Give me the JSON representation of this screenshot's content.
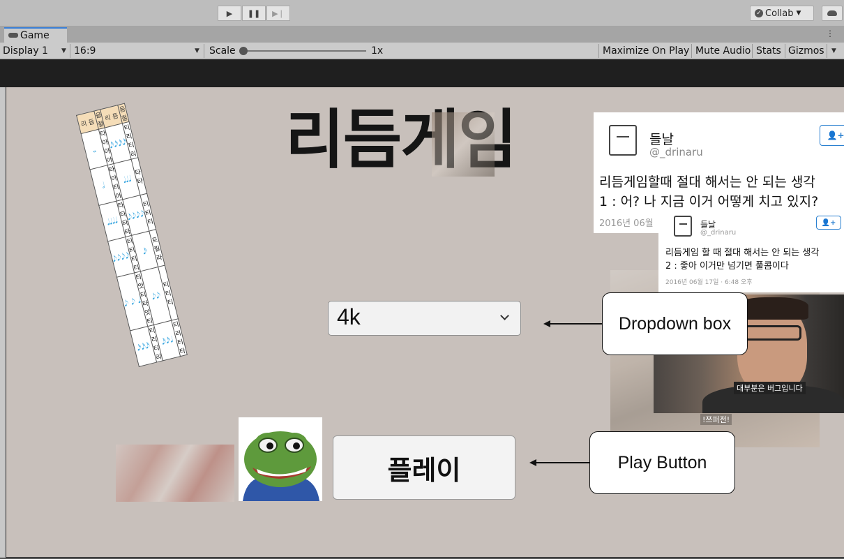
{
  "toolbar": {
    "collab_label": "Collab"
  },
  "tabs": [
    {
      "label": "Game"
    }
  ],
  "controls": {
    "display": "Display 1",
    "aspect": "16:9",
    "scale_label": "Scale",
    "scale_value": "1x",
    "maximize_on_play": "Maximize On Play",
    "mute_audio": "Mute Audio",
    "stats": "Stats",
    "gizmos": "Gizmos"
  },
  "game": {
    "title": "리듬게임",
    "dropdown_value": "4k",
    "play_button": "플레이"
  },
  "rhythm_table": {
    "headers": [
      "리 듬",
      "음 절",
      "리 듬",
      "음 절"
    ],
    "rows": [
      [
        "𝅝",
        "타 아 아 아",
        "𝅘𝅥𝅯𝅘𝅥𝅯𝅘𝅥𝅯𝅘𝅥𝅯",
        "티리 티리"
      ],
      [
        "𝅗𝅥",
        "타 아 타 아",
        "𝅘𝅥𝅘𝅥𝅘𝅥",
        "타 타"
      ],
      [
        "𝅘𝅥𝅘𝅥𝅘𝅥𝅘𝅥",
        "타 타 타 타",
        "𝅘𝅥𝅮𝅘𝅥𝅮𝅘𝅥𝅮𝅘𝅥𝅮",
        "티 티 티"
      ],
      [
        "𝅘𝅥𝅮𝅘𝅥𝅮𝅘𝅥𝅮𝅘𝅥𝅮",
        "티티 티티",
        "𝅘𝅥𝅯",
        "트릴라"
      ],
      [
        "𝅘𝅥𝅮 𝅘𝅥𝅮 𝅘𝅥",
        "타앗티 타앗티",
        "𝅘𝅥𝅮𝅘𝅥𝅮",
        "티티 티"
      ],
      [
        "𝅘𝅥𝅯𝅘𝅥𝅯𝅘𝅥𝅯",
        "티리 티리",
        "𝅘𝅥𝅯𝅘𝅥𝅯𝅘𝅥",
        "티리티 타"
      ]
    ]
  },
  "tweet1": {
    "name": "들날",
    "handle": "@_drinaru",
    "line1": "리듬게임할때 절대 해서는 안 되는 생각",
    "line2": "1 : 어? 나 지금 이거 어떻게 치고 있지?",
    "date": "2016년 06월"
  },
  "tweet2": {
    "name": "들날",
    "handle": "@_drinaru",
    "line1": "리듬게임 할 때 절대 해서는 안 되는 생각",
    "line2": "2 : 좋아 이거만 넘기면 풀콤이다",
    "date": "2016년 06월 17일 · 6:48 오후"
  },
  "video": {
    "subtitle": "대부분은 버그입니다",
    "caption": "!쯔퍼전!"
  },
  "annotations": {
    "dropdown": "Dropdown box",
    "play": "Play Button"
  },
  "icons": [
    "play-icon",
    "pause-icon",
    "step-icon",
    "check-icon",
    "cloud-icon",
    "gamepad-icon",
    "kebab-menu-icon",
    "chevron-down-icon",
    "follow-user-icon"
  ]
}
